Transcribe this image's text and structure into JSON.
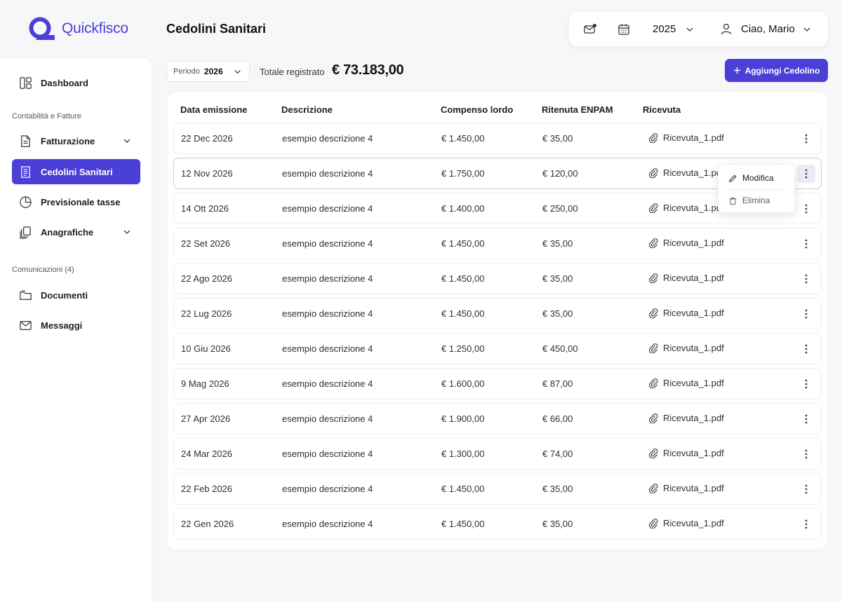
{
  "app": {
    "name": "Quickfisco"
  },
  "page": {
    "title": "Cedolini Sanitari"
  },
  "topbar": {
    "year": "2025",
    "greeting": "Ciao, Mario"
  },
  "sidebar": {
    "items": [
      {
        "label": "Dashboard"
      },
      {
        "section": "Contabilità e Fatture"
      },
      {
        "label": "Fatturazione"
      },
      {
        "label": "Cedolini Sanitari"
      },
      {
        "label": "Previsionale tasse"
      },
      {
        "label": "Anagrafiche"
      },
      {
        "section": "Comunicazioni (4)"
      },
      {
        "label": "Documenti"
      },
      {
        "label": "Messaggi"
      }
    ]
  },
  "filters": {
    "period_label": "Periodo",
    "period_value": "2026",
    "total_label": "Totale registrato",
    "total_value": "€ 73.183,00",
    "add_button": "Aggiungi Cedolino"
  },
  "table": {
    "columns": [
      "Data emissione",
      "Descrizione",
      "Compenso lordo",
      "Ritenuta ENPAM",
      "Ricevuta"
    ],
    "rows": [
      [
        "22 Dec 2026",
        "esempio descrizione 4",
        "€ 1.450,00",
        "€ 35,00",
        "Ricevuta_1.pdf"
      ],
      [
        "12 Nov 2026",
        "esempio descrizione 4",
        "€ 1.750,00",
        "€ 120,00",
        "Ricevuta_1.pdf"
      ],
      [
        "14 Ott 2026",
        "esempio descrizione 4",
        "€ 1.400,00",
        "€ 250,00",
        "Ricevuta_1.pdf"
      ],
      [
        "22 Set 2026",
        "esempio descrizione 4",
        "€ 1.450,00",
        "€ 35,00",
        "Ricevuta_1.pdf"
      ],
      [
        "22 Ago 2026",
        "esempio descrizione 4",
        "€ 1.450,00",
        "€ 35,00",
        "Ricevuta_1.pdf"
      ],
      [
        "22 Lug 2026",
        "esempio descrizione 4",
        "€ 1.450,00",
        "€ 35,00",
        "Ricevuta_1.pdf"
      ],
      [
        "10 Giu 2026",
        "esempio descrizione 4",
        "€ 1.250,00",
        "€ 450,00",
        "Ricevuta_1.pdf"
      ],
      [
        "9 Mag 2026",
        "esempio descrizione 4",
        "€ 1.600,00",
        "€ 87,00",
        "Ricevuta_1.pdf"
      ],
      [
        "27 Apr 2026",
        "esempio descrizione 4",
        "€ 1.900,00",
        "€ 66,00",
        "Ricevuta_1.pdf"
      ],
      [
        "24 Mar 2026",
        "esempio descrizione 4",
        "€ 1.300,00",
        "€ 74,00",
        "Ricevuta_1.pdf"
      ],
      [
        "22 Feb 2026",
        "esempio descrizione 4",
        "€ 1.450,00",
        "€ 35,00",
        "Ricevuta_1.pdf"
      ],
      [
        "22 Gen 2026",
        "esempio descrizione 4",
        "€ 1.450,00",
        "€ 35,00",
        "Ricevuta_1.pdf"
      ]
    ]
  },
  "row_menu": {
    "edit": "Modifica",
    "delete": "Elimina"
  },
  "colors": {
    "primary": "#4a3fd6",
    "background": "#f7f7fa"
  },
  "icons": {
    "logo": "quickfisco-logo-icon",
    "mail": "mail-icon",
    "calendar": "calendar-icon",
    "user": "user-icon",
    "attachment": "paperclip-icon",
    "kebab": "kebab-menu-icon",
    "edit": "pencil-icon",
    "delete": "trash-icon"
  }
}
